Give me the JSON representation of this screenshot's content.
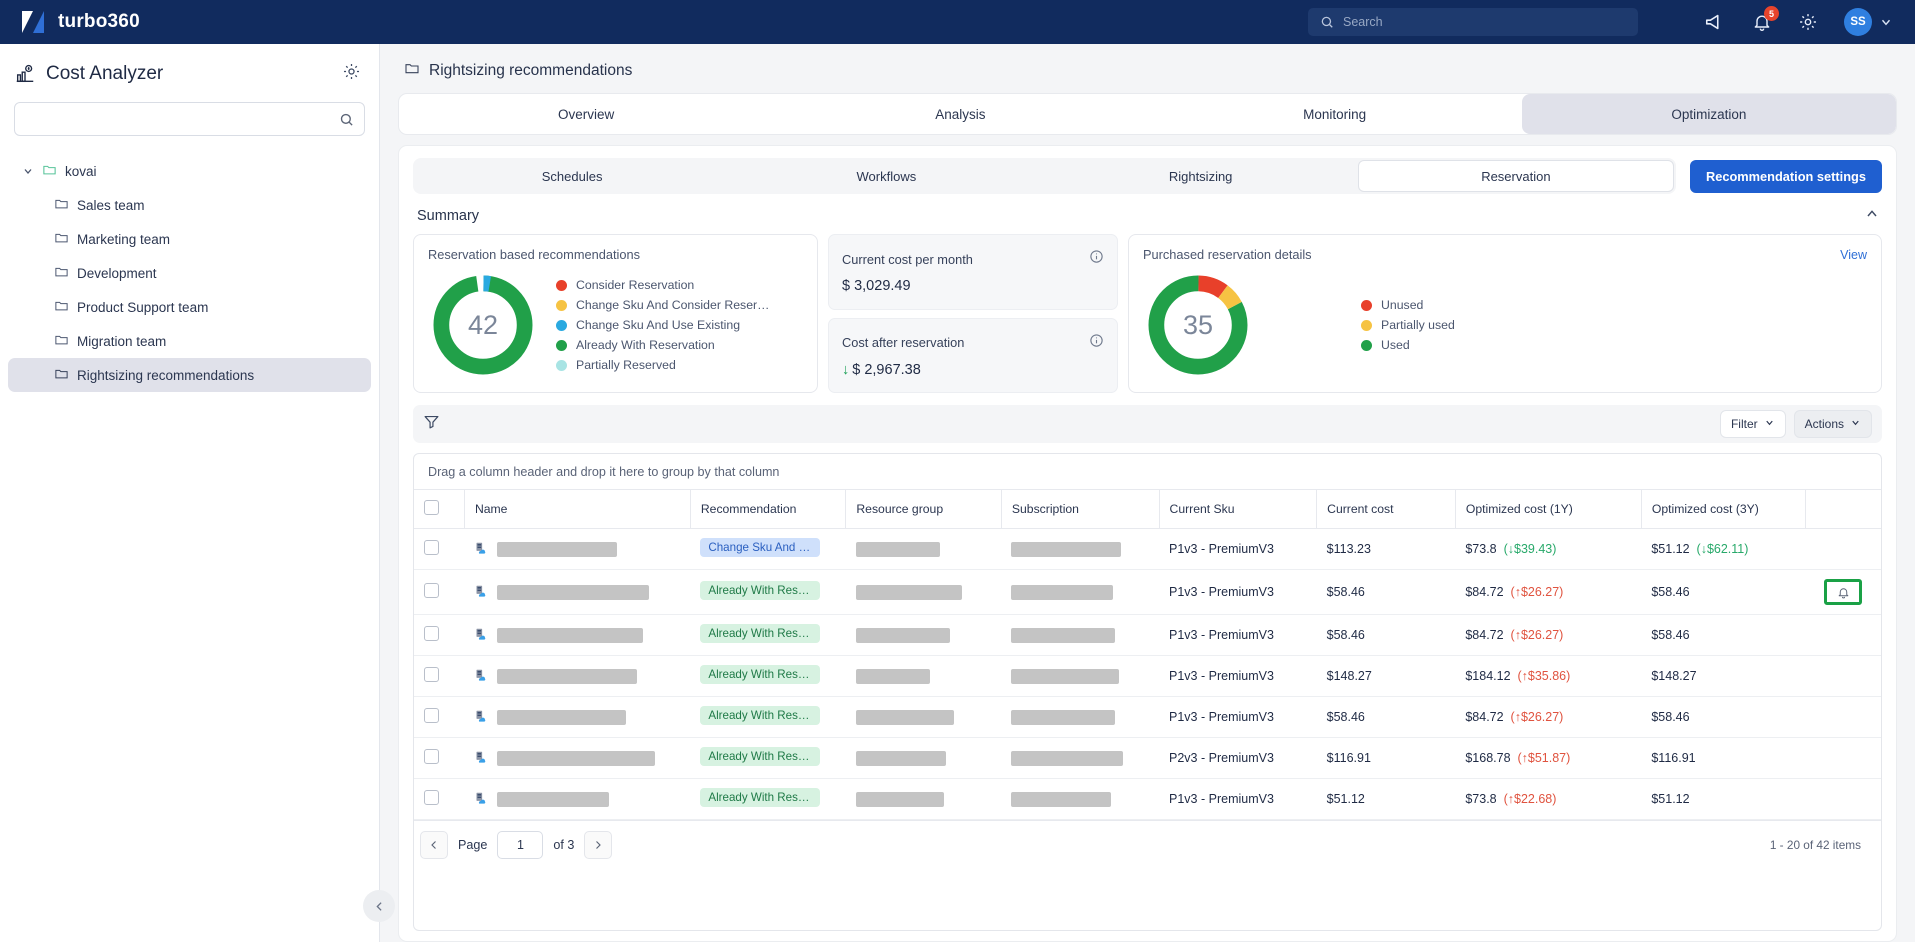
{
  "topbar": {
    "brand": "turbo360",
    "search_placeholder": "Search",
    "announce_icon": "megaphone-icon",
    "bell_icon": "bell-icon",
    "notification_count": "5",
    "gear_icon": "gear-icon",
    "avatar_initials": "SS",
    "chevron_icon": "chevron-down-icon"
  },
  "sidebar": {
    "title": "Cost Analyzer",
    "title_icon": "cost-analyzer-icon",
    "gear_icon": "gear-icon",
    "search_placeholder": "",
    "search_icon": "search-icon",
    "collapse_icon": "chevron-left-icon",
    "root": {
      "label": "kovai",
      "icon": "folder-icon"
    },
    "items": [
      {
        "label": "Sales team",
        "icon": "folder-icon",
        "selected": false
      },
      {
        "label": "Marketing team",
        "icon": "folder-icon",
        "selected": false
      },
      {
        "label": "Development",
        "icon": "folder-icon",
        "selected": false
      },
      {
        "label": "Product Support team",
        "icon": "folder-icon",
        "selected": false
      },
      {
        "label": "Migration team",
        "icon": "folder-icon",
        "selected": false
      },
      {
        "label": "Rightsizing recommendations",
        "icon": "folder-icon",
        "selected": true
      }
    ]
  },
  "breadcrumb": {
    "icon": "folder-icon",
    "label": "Rightsizing recommendations"
  },
  "tabs": [
    {
      "label": "Overview",
      "active": false
    },
    {
      "label": "Analysis",
      "active": false
    },
    {
      "label": "Monitoring",
      "active": false
    },
    {
      "label": "Optimization",
      "active": true
    }
  ],
  "subtabs": [
    {
      "label": "Schedules",
      "active": false
    },
    {
      "label": "Workflows",
      "active": false
    },
    {
      "label": "Rightsizing",
      "active": false
    },
    {
      "label": "Reservation",
      "active": true
    }
  ],
  "recommendation_settings_button": "Recommendation settings",
  "summary": {
    "title": "Summary",
    "collapse_icon": "chevron-up-icon",
    "reservation_card": {
      "title": "Reservation based recommendations",
      "center_value": "42",
      "legend": [
        {
          "label": "Consider Reservation",
          "color": "#e8402a"
        },
        {
          "label": "Change Sku And Consider Reser…",
          "color": "#f6c343"
        },
        {
          "label": "Change Sku And Use Existing",
          "color": "#2aa9e0"
        },
        {
          "label": "Already With Reservation",
          "color": "#21a049"
        },
        {
          "label": "Partially Reserved",
          "color": "#a8e4e4"
        }
      ]
    },
    "cost_cards": [
      {
        "label": "Current cost per month",
        "value": "$ 3,029.49",
        "info_icon": "info-icon",
        "trend": ""
      },
      {
        "label": "Cost after reservation",
        "value": "$ 2,967.38",
        "info_icon": "info-icon",
        "trend": "↓"
      }
    ],
    "purchased_card": {
      "title": "Purchased reservation details",
      "view_label": "View",
      "center_value": "35",
      "legend": [
        {
          "label": "Unused",
          "color": "#e8402a"
        },
        {
          "label": "Partially used",
          "color": "#f6c343"
        },
        {
          "label": "Used",
          "color": "#21a049"
        }
      ]
    }
  },
  "chart_data": [
    {
      "type": "pie",
      "title": "Reservation based recommendations",
      "center_label": "42",
      "categories": [
        "Consider Reservation",
        "Change Sku And Consider Reser…",
        "Change Sku And Use Existing",
        "Already With Reservation",
        "Partially Reserved"
      ],
      "values": [
        0,
        0,
        1,
        41,
        0
      ],
      "colors": [
        "#e8402a",
        "#f6c343",
        "#2aa9e0",
        "#21a049",
        "#a8e4e4"
      ],
      "legend_position": "right"
    },
    {
      "type": "pie",
      "title": "Purchased reservation details",
      "center_label": "35",
      "categories": [
        "Unused",
        "Partially used",
        "Used"
      ],
      "values": [
        4,
        2,
        29
      ],
      "colors": [
        "#e8402a",
        "#f6c343",
        "#21a049"
      ],
      "legend_position": "right"
    }
  ],
  "toolbar": {
    "filter_icon": "funnel-icon",
    "filter_label": "Filter",
    "actions_label": "Actions",
    "chevron_icon": "chevron-down-icon"
  },
  "grid": {
    "group_hint": "Drag a column header and drop it here to group by that column",
    "columns": [
      "",
      "Name",
      "Recommendation",
      "Resource group",
      "Subscription",
      "Current Sku",
      "Current cost",
      "Optimized cost (1Y)",
      "Optimized cost (3Y)",
      ""
    ],
    "rows": [
      {
        "name_width": 120,
        "recommendation": "Change Sku And Us…",
        "rec_style": "blue",
        "resource_group_width": 84,
        "subscription_width": 110,
        "current_sku": "P1v3 - PremiumV3",
        "current_cost": "$113.23",
        "opt1y": "$73.8",
        "opt1y_delta": "(↓$39.43)",
        "opt1y_dir": "down",
        "opt3y": "$51.12",
        "opt3y_delta": "(↓$62.11)",
        "opt3y_dir": "down",
        "bell": false
      },
      {
        "name_width": 152,
        "recommendation": "Already With Reser…",
        "rec_style": "green",
        "resource_group_width": 106,
        "subscription_width": 102,
        "current_sku": "P1v3 - PremiumV3",
        "current_cost": "$58.46",
        "opt1y": "$84.72",
        "opt1y_delta": "(↑$26.27)",
        "opt1y_dir": "up",
        "opt3y": "$58.46",
        "opt3y_delta": "",
        "opt3y_dir": "",
        "bell": true
      },
      {
        "name_width": 146,
        "recommendation": "Already With Reser…",
        "rec_style": "green",
        "resource_group_width": 94,
        "subscription_width": 104,
        "current_sku": "P1v3 - PremiumV3",
        "current_cost": "$58.46",
        "opt1y": "$84.72",
        "opt1y_delta": "(↑$26.27)",
        "opt1y_dir": "up",
        "opt3y": "$58.46",
        "opt3y_delta": "",
        "opt3y_dir": "",
        "bell": false
      },
      {
        "name_width": 140,
        "recommendation": "Already With Reser…",
        "rec_style": "green",
        "resource_group_width": 74,
        "subscription_width": 108,
        "current_sku": "P1v3 - PremiumV3",
        "current_cost": "$148.27",
        "opt1y": "$184.12",
        "opt1y_delta": "(↑$35.86)",
        "opt1y_dir": "up",
        "opt3y": "$148.27",
        "opt3y_delta": "",
        "opt3y_dir": "",
        "bell": false
      },
      {
        "name_width": 129,
        "recommendation": "Already With Reser…",
        "rec_style": "green",
        "resource_group_width": 98,
        "subscription_width": 104,
        "current_sku": "P1v3 - PremiumV3",
        "current_cost": "$58.46",
        "opt1y": "$84.72",
        "opt1y_delta": "(↑$26.27)",
        "opt1y_dir": "up",
        "opt3y": "$58.46",
        "opt3y_delta": "",
        "opt3y_dir": "",
        "bell": false
      },
      {
        "name_width": 158,
        "recommendation": "Already With Reser…",
        "rec_style": "green",
        "resource_group_width": 90,
        "subscription_width": 112,
        "current_sku": "P2v3 - PremiumV3",
        "current_cost": "$116.91",
        "opt1y": "$168.78",
        "opt1y_delta": "(↑$51.87)",
        "opt1y_dir": "up",
        "opt3y": "$116.91",
        "opt3y_delta": "",
        "opt3y_dir": "",
        "bell": false
      },
      {
        "name_width": 112,
        "recommendation": "Already With Reser…",
        "rec_style": "green",
        "resource_group_width": 88,
        "subscription_width": 100,
        "current_sku": "P1v3 - PremiumV3",
        "current_cost": "$51.12",
        "opt1y": "$73.8",
        "opt1y_delta": "(↑$22.68)",
        "opt1y_dir": "up",
        "opt3y": "$51.12",
        "opt3y_delta": "",
        "opt3y_dir": "",
        "bell": false
      }
    ]
  },
  "pagination": {
    "prev_icon": "chevron-left-icon",
    "next_icon": "chevron-right-icon",
    "page_label": "Page",
    "page_value": "1",
    "of_label": "of 3",
    "summary": "1 - 20 of 42 items"
  }
}
